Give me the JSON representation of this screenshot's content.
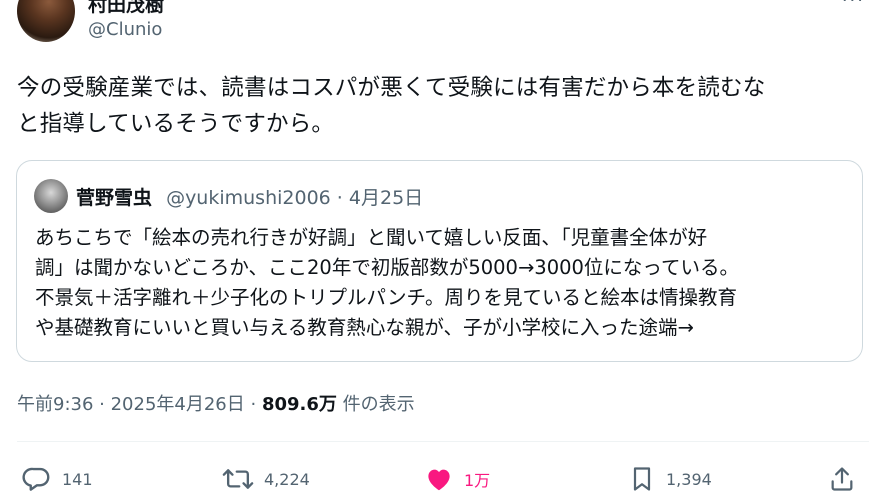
{
  "author": {
    "display_name": "村田茂樹",
    "handle": "@Clunio"
  },
  "tweet": {
    "text_line1": "今の受験産業では、読書はコスパが悪くて受験には有害だから本を読むな",
    "text_line2": "と指導しているそうですから。"
  },
  "quote": {
    "name": "菅野雪虫",
    "handle": "@yukimushi2006",
    "separator": " · ",
    "date": "4月25日",
    "line1": "あちこちで「絵本の売れ行きが好調」と聞いて嬉しい反面、「児童書全体が好",
    "line2": "調」は聞かないどころか、ここ20年で初版部数が5000→3000位になっている。",
    "line3": "不景気＋活字離れ＋少子化のトリプルパンチ。周りを見ていると絵本は情操教育",
    "line4": "や基礎教育にいいと買い与える教育熱心な親が、子が小学校に入った途端→"
  },
  "meta": {
    "time": "午前9:36",
    "sep1": " · ",
    "date": "2025年4月26日",
    "sep2": " · ",
    "views": "809.6万",
    "views_label": " 件の表示"
  },
  "actions": {
    "replies": "141",
    "retweets": "4,224",
    "likes": "1万",
    "bookmarks": "1,394"
  },
  "colors": {
    "text": "#0f1419",
    "secondary": "#536471",
    "like": "#f91880",
    "border": "#cfd9de"
  },
  "icons": [
    "more-icon",
    "reply-icon",
    "retweet-icon",
    "like-icon",
    "bookmark-icon",
    "share-icon"
  ]
}
